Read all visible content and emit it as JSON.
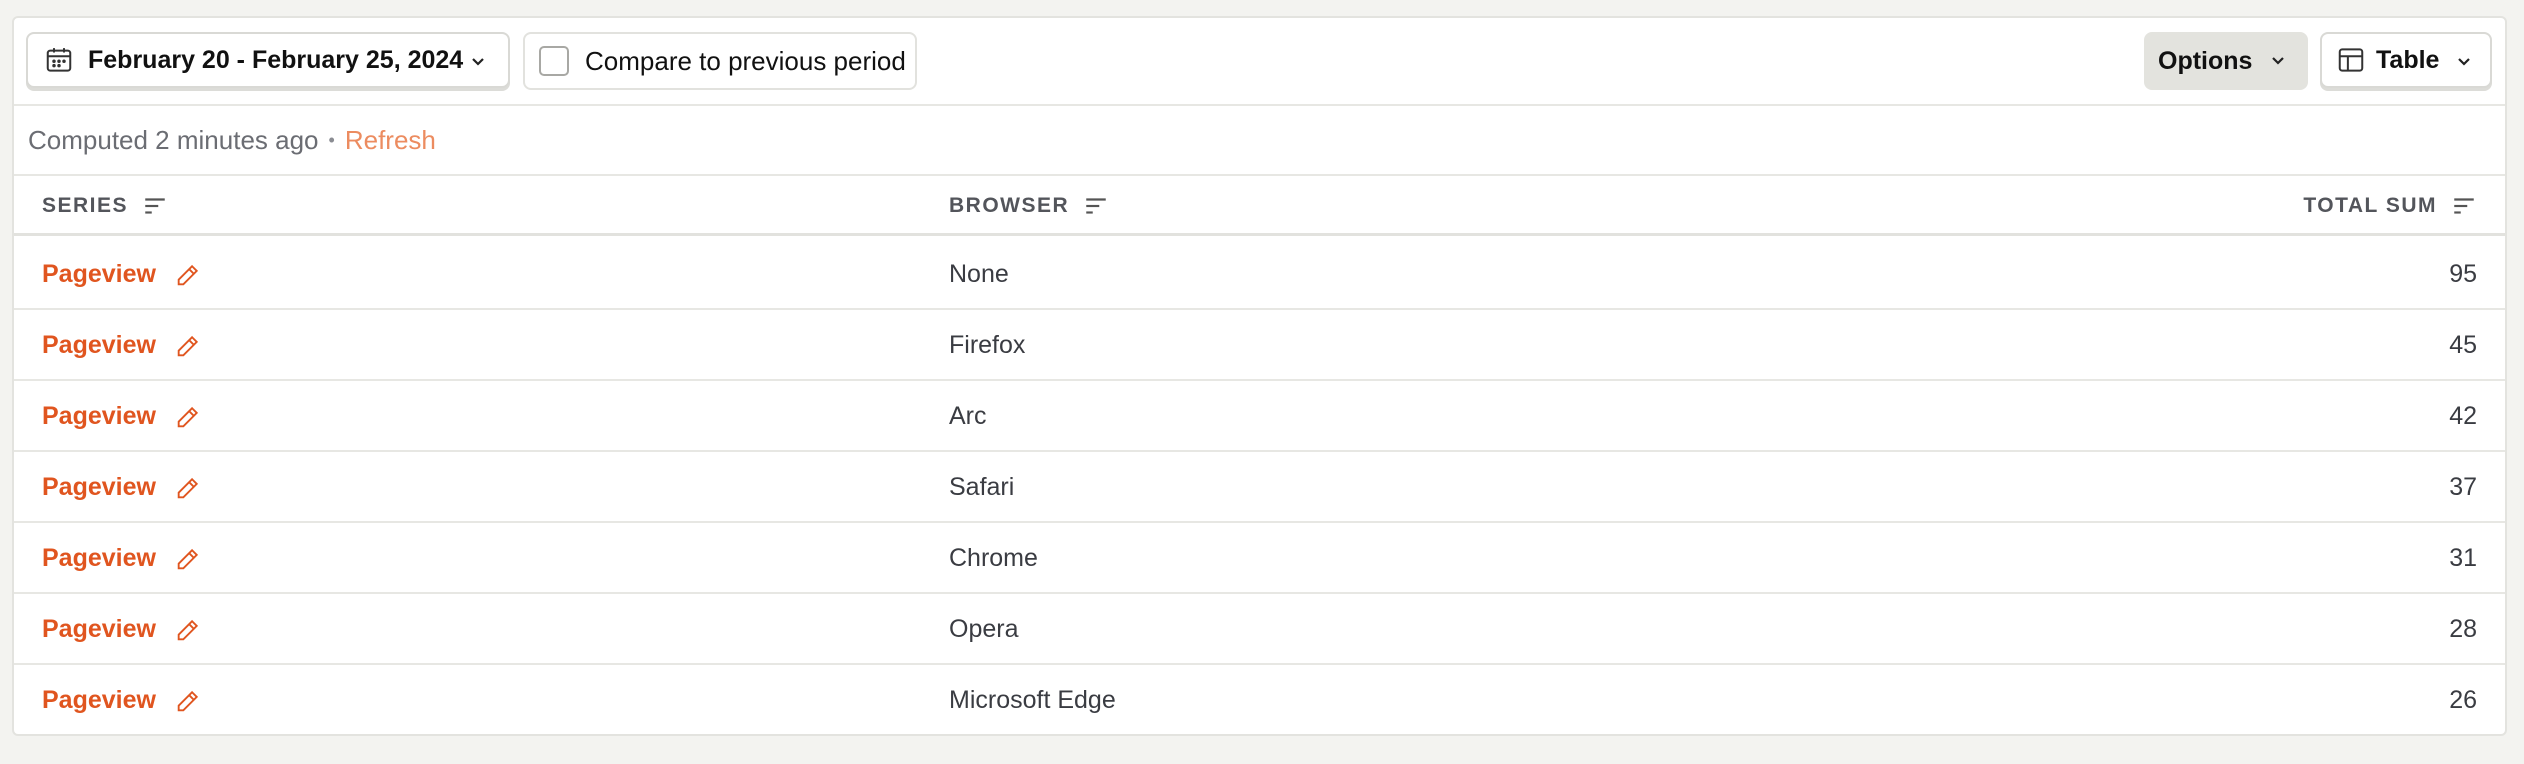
{
  "toolbar": {
    "date_range": "February 20 - February 25, 2024",
    "compare_label": "Compare to previous period",
    "compare_checked": false,
    "options_label": "Options",
    "view_label": "Table"
  },
  "status": {
    "computed_text": "Computed 2 minutes ago",
    "separator": "•",
    "refresh_label": "Refresh"
  },
  "table": {
    "columns": [
      "SERIES",
      "BROWSER",
      "TOTAL SUM"
    ],
    "rows": [
      {
        "series": "Pageview",
        "browser": "None",
        "total": "95"
      },
      {
        "series": "Pageview",
        "browser": "Firefox",
        "total": "45"
      },
      {
        "series": "Pageview",
        "browser": "Arc",
        "total": "42"
      },
      {
        "series": "Pageview",
        "browser": "Safari",
        "total": "37"
      },
      {
        "series": "Pageview",
        "browser": "Chrome",
        "total": "31"
      },
      {
        "series": "Pageview",
        "browser": "Opera",
        "total": "28"
      },
      {
        "series": "Pageview",
        "browser": "Microsoft Edge",
        "total": "26"
      }
    ]
  },
  "colors": {
    "series_link": "#e0551f",
    "refresh_link": "#ec8c60",
    "options_bg": "#e3e3de"
  },
  "icons": {
    "date": "calendar-icon",
    "chevron": "chevron-down-icon",
    "view": "table-icon",
    "sort": "sort-icon",
    "edit": "pencil-icon"
  }
}
